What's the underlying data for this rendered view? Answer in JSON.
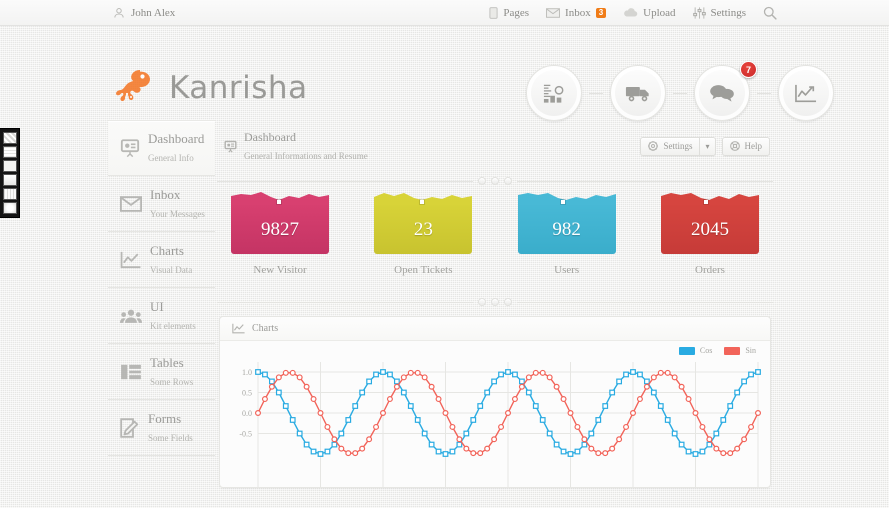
{
  "topbar": {
    "user": {
      "name": "John Alex",
      "icon": "user-icon"
    },
    "items": [
      {
        "label": "Pages",
        "icon": "page-icon",
        "badge": null
      },
      {
        "label": "Inbox",
        "icon": "envelope-icon",
        "badge": "3"
      },
      {
        "label": "Upload",
        "icon": "cloud-upload-icon",
        "badge": null
      },
      {
        "label": "Settings",
        "icon": "sliders-icon",
        "badge": null
      }
    ],
    "search_icon": "search-icon",
    "badge_color": "#f07c17"
  },
  "brand": {
    "name": "Kanrisha",
    "logo_icon": "salamander-logo-icon",
    "logo_color": "#f47321"
  },
  "circle_nav": [
    {
      "name": "stats",
      "icon": "bar-stats-icon",
      "badge": null
    },
    {
      "name": "shipping",
      "icon": "truck-icon",
      "badge": null
    },
    {
      "name": "messages",
      "icon": "chat-bubbles-icon",
      "badge": "7"
    },
    {
      "name": "analytics",
      "icon": "line-chart-icon",
      "badge": null
    }
  ],
  "badge_red": "#d5302e",
  "pattern_switcher": {
    "count": 6,
    "name": "background-pattern-picker"
  },
  "sidebar": {
    "items": [
      {
        "title": "Dashboard",
        "sub": "General Info",
        "icon": "presentation-icon",
        "active": true
      },
      {
        "title": "Inbox",
        "sub": "Your Messages",
        "icon": "envelope-icon",
        "active": false
      },
      {
        "title": "Charts",
        "sub": "Visual Data",
        "icon": "line-chart-icon",
        "active": false
      },
      {
        "title": "UI",
        "sub": "Kit elements",
        "icon": "users-icon",
        "active": false
      },
      {
        "title": "Tables",
        "sub": "Some Rows",
        "icon": "table-icon",
        "active": false
      },
      {
        "title": "Forms",
        "sub": "Some Fields",
        "icon": "edit-pencil-icon",
        "active": false
      }
    ]
  },
  "page": {
    "icon": "presentation-icon",
    "title": "Dashboard",
    "subtitle": "General Informations and Resume",
    "settings_label": "Settings",
    "settings_icon": "gear-icon",
    "caret": "▾",
    "help_label": "Help",
    "help_icon": "lifebuoy-icon"
  },
  "stats": [
    {
      "value": "9827",
      "label": "New Visitor",
      "color": "#d84070",
      "color_dark": "#c43464"
    },
    {
      "value": "23",
      "label": "Open Tickets",
      "color": "#d8d338",
      "color_dark": "#c8c32f"
    },
    {
      "value": "982",
      "label": "Users",
      "color": "#48b9d6",
      "color_dark": "#3aadcb"
    },
    {
      "value": "2045",
      "label": "Orders",
      "color": "#d6453f",
      "color_dark": "#c63b38"
    }
  ],
  "chart_panel": {
    "title": "Charts",
    "icon": "line-chart-icon"
  },
  "chart_data": {
    "type": "line",
    "title": "Charts",
    "xlabel": "",
    "ylabel": "",
    "ylim": [
      -1.0,
      1.0
    ],
    "yticks": [
      "1.0",
      "0.5",
      "0.0",
      "-0.5"
    ],
    "ytick_values": [
      1.0,
      0.5,
      0.0,
      -0.5
    ],
    "grid": true,
    "legend_position": "top-right",
    "x": [
      0,
      1,
      2,
      3,
      4,
      5,
      6,
      7,
      8,
      9,
      10,
      11,
      12,
      13,
      14,
      15,
      16,
      17,
      18,
      19,
      20,
      21,
      22,
      23,
      24,
      25,
      26,
      27,
      28,
      29,
      30,
      31,
      32,
      33,
      34,
      35,
      36,
      37,
      38,
      39,
      40,
      41,
      42,
      43,
      44,
      45,
      46,
      47,
      48,
      49,
      50,
      51,
      52,
      53,
      54,
      55,
      56,
      57,
      58,
      59,
      60,
      61,
      62,
      63,
      64,
      65,
      66,
      67,
      68,
      69,
      70,
      71,
      72
    ],
    "series": [
      {
        "name": "Cos",
        "color": "#29abe2",
        "marker": "square",
        "function": "cos",
        "period_points": 18,
        "values": [
          1.0,
          0.94,
          0.77,
          0.5,
          0.17,
          -0.17,
          -0.5,
          -0.77,
          -0.94,
          -1.0,
          -0.94,
          -0.77,
          -0.5,
          -0.17,
          0.17,
          0.5,
          0.77,
          0.94,
          1.0,
          0.94,
          0.77,
          0.5,
          0.17,
          -0.17,
          -0.5,
          -0.77,
          -0.94,
          -1.0,
          -0.94,
          -0.77,
          -0.5,
          -0.17,
          0.17,
          0.5,
          0.77,
          0.94,
          1.0,
          0.94,
          0.77,
          0.5,
          0.17,
          -0.17,
          -0.5,
          -0.77,
          -0.94,
          -1.0,
          -0.94,
          -0.77,
          -0.5,
          -0.17,
          0.17,
          0.5,
          0.77,
          0.94,
          1.0,
          0.94,
          0.77,
          0.5,
          0.17,
          -0.17,
          -0.5,
          -0.77,
          -0.94,
          -1.0,
          -0.94,
          -0.77,
          -0.5,
          -0.17,
          0.17,
          0.5,
          0.77,
          0.94,
          1.0
        ]
      },
      {
        "name": "Sin",
        "color": "#f2645a",
        "marker": "circle",
        "function": "sin",
        "period_points": 18,
        "values": [
          0.0,
          0.34,
          0.64,
          0.87,
          0.98,
          0.98,
          0.87,
          0.64,
          0.34,
          0.0,
          -0.34,
          -0.64,
          -0.87,
          -0.98,
          -0.98,
          -0.87,
          -0.64,
          -0.34,
          0.0,
          0.34,
          0.64,
          0.87,
          0.98,
          0.98,
          0.87,
          0.64,
          0.34,
          0.0,
          -0.34,
          -0.64,
          -0.87,
          -0.98,
          -0.98,
          -0.87,
          -0.64,
          -0.34,
          0.0,
          0.34,
          0.64,
          0.87,
          0.98,
          0.98,
          0.87,
          0.64,
          0.34,
          0.0,
          -0.34,
          -0.64,
          -0.87,
          -0.98,
          -0.98,
          -0.87,
          -0.64,
          -0.34,
          0.0,
          0.34,
          0.64,
          0.87,
          0.98,
          0.98,
          0.87,
          0.64,
          0.34,
          0.0,
          -0.34,
          -0.64,
          -0.87,
          -0.98,
          -0.98,
          -0.87,
          -0.64,
          -0.34,
          0.0
        ]
      }
    ]
  }
}
